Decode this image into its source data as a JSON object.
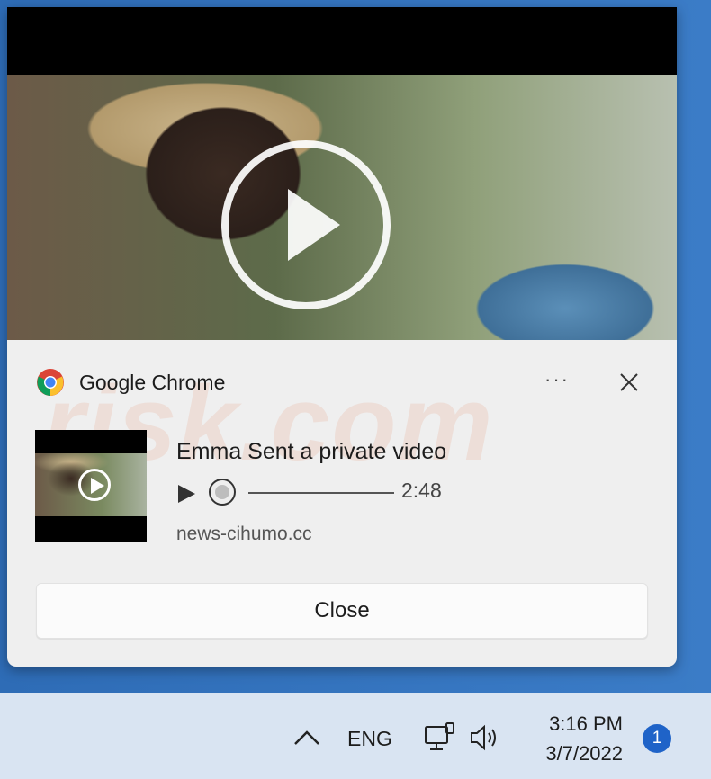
{
  "notification": {
    "app_name": "Google Chrome",
    "more_label": "···",
    "title": "Emma Sent a private video",
    "duration": "2:48",
    "source": "news-cihumo.cc",
    "close_label": "Close"
  },
  "watermark": "risk.com",
  "taskbar": {
    "language": "ENG",
    "time": "3:16 PM",
    "date": "3/7/2022",
    "notification_count": "1"
  },
  "colors": {
    "accent": "#1f63c8",
    "toast_bg": "#efefef",
    "taskbar_bg": "#d9e4f2"
  },
  "icons": [
    "chrome-icon",
    "more-icon",
    "close-icon",
    "play-icon",
    "chevron-up-icon",
    "network-icon",
    "volume-icon"
  ]
}
